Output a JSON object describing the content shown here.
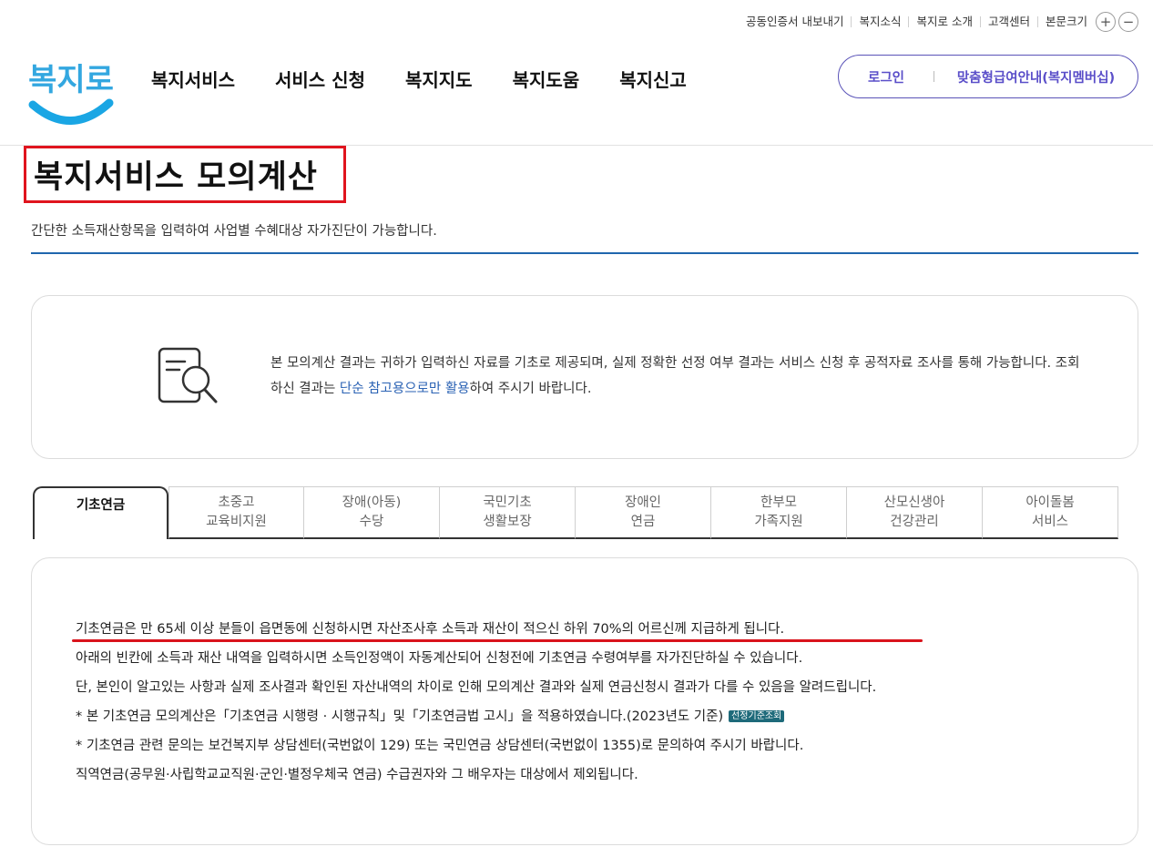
{
  "utility": {
    "cert_export": "공동인증서 내보내기",
    "news": "복지소식",
    "about": "복지로 소개",
    "customer_center": "고객센터",
    "text_size": "본문크기",
    "zoom_in": "+",
    "zoom_out": "−"
  },
  "logo": {
    "text": "복지로"
  },
  "gnb": [
    "복지서비스",
    "서비스 신청",
    "복지지도",
    "복지도움",
    "복지신고"
  ],
  "account": {
    "login": "로그인",
    "membership": "맞춤형급여안내(복지멤버십)"
  },
  "page": {
    "title": "복지서비스 모의계산",
    "subtitle": "간단한 소득재산항목을 입력하여 사업별 수혜대상 자가진단이 가능합니다."
  },
  "notice": {
    "text_part1": "본 모의계산 결과는 귀하가 입력하신 자료를 기초로 제공되며, 실제 정확한 선정 여부 결과는 서비스 신청 후 공적자료 조사를 통해 가능합니다. 조회하신 결과는 ",
    "highlight": "단순 참고용으로만 활용",
    "text_part2": "하여 주시기 바랍니다."
  },
  "tabs": [
    {
      "line1": "기초연금",
      "line2": ""
    },
    {
      "line1": "초중고",
      "line2": "교육비지원"
    },
    {
      "line1": "장애(아동)",
      "line2": "수당"
    },
    {
      "line1": "국민기초",
      "line2": "생활보장"
    },
    {
      "line1": "장애인",
      "line2": "연금"
    },
    {
      "line1": "한부모",
      "line2": "가족지원"
    },
    {
      "line1": "산모신생아",
      "line2": "건강관리"
    },
    {
      "line1": "아이돌봄",
      "line2": "서비스"
    }
  ],
  "content": {
    "line1": "기초연금은 만 65세 이상 분들이 읍면동에 신청하시면 자산조사후 소득과 재산이 적으신 하위 70%의 어르신께 지급하게 됩니다.",
    "line2": "아래의 빈칸에 소득과 재산 내역을 입력하시면 소득인정액이 자동계산되어 신청전에 기초연금 수령여부를 자가진단하실 수 있습니다.",
    "line3": "단, 본인이 알고있는 사항과 실제 조사결과 확인된 자산내역의 차이로 인해 모의계산 결과와 실제 연금신청시 결과가 다를 수 있음을 알려드립니다.",
    "line4": "* 본 기초연금 모의계산은「기초연금 시행령 · 시행규칙」및「기초연금법 고시」을 적용하였습니다.(2023년도 기준)",
    "badge": "선정기준조회",
    "line5": "* 기초연금 관련 문의는 보건복지부 상담센터(국번없이 129) 또는 국민연금 상담센터(국번없이 1355)로 문의하여 주시기 바랍니다.",
    "line6": "직역연금(공무원·사립학교교직원·군인·별정우체국 연금) 수급권자와 그 배우자는 대상에서 제외됩니다."
  },
  "colors": {
    "brand_purple": "#5b4fc9",
    "highlight_red": "#e0141e",
    "accent_blue": "#1f66ad",
    "badge_teal": "#1e6a7a"
  }
}
